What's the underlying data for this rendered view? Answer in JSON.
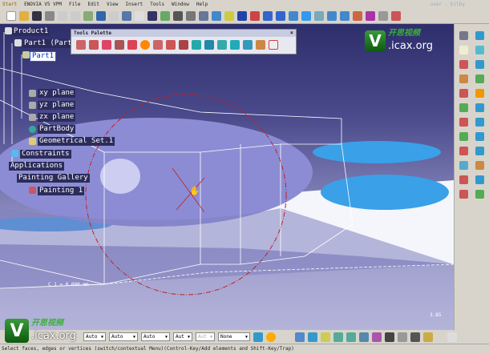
{
  "menu": {
    "items": [
      "Start",
      "ENOVIA V5 VPM",
      "File",
      "Edit",
      "View",
      "Insert",
      "Tools",
      "Window",
      "Help"
    ]
  },
  "user_badge": "user : bilby",
  "palette": {
    "title": "Tools Palette",
    "close": "×"
  },
  "tree": {
    "product": "Product1",
    "part_instance": "Part1 (Part",
    "part": "Part1",
    "xy": "xy plane",
    "yz": "yz plane",
    "zx": "zx plane",
    "body": "PartBody",
    "geoset": "Geometrical Set.1",
    "constraints": "Constraints",
    "applications": "Applications",
    "gallery": "Painting Gallery",
    "painting": "Painting 1"
  },
  "watermark": {
    "letter": "V",
    "cn": "开思视频",
    "site": ".icax.org"
  },
  "viewport": {
    "coord_readout": "C 1 = 0.000 mm",
    "zoom_readout": "3.85"
  },
  "bottom": {
    "selects": [
      "Auto",
      "Auto",
      "Auto",
      "Aut",
      "Aut",
      "None"
    ]
  },
  "status": "Select faces, edges or vertices (switch/contextual Menu)(Control-Key/Add elements and Shift-Key/Trap)",
  "colors": {
    "accent": "#2e2e6c",
    "selection": "#3050ff",
    "circle": "#c02020"
  }
}
